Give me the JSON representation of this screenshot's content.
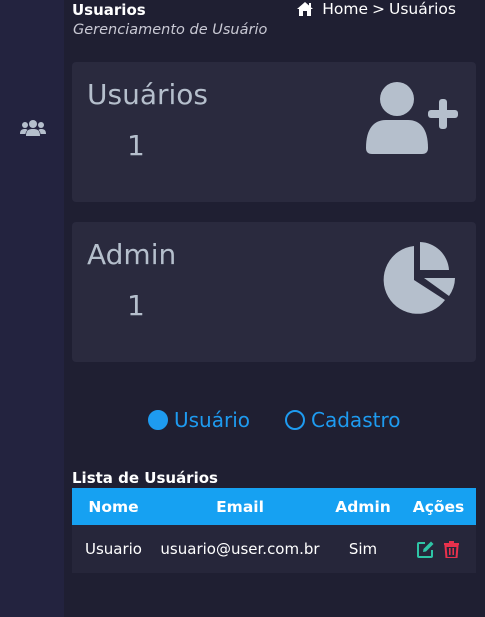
{
  "sidebar": {
    "items": [
      {
        "icon": "users-icon"
      }
    ]
  },
  "header": {
    "title": "Usuarios",
    "subtitle": "Gerenciamento de Usuário",
    "breadcrumb": {
      "home": "Home",
      "separator": ">",
      "current": "Usuários"
    }
  },
  "cards": [
    {
      "label": "Usuários",
      "value": "1",
      "icon": "user-plus-icon"
    },
    {
      "label": "Admin",
      "value": "1",
      "icon": "pie-chart-icon"
    }
  ],
  "view_toggle": {
    "options": [
      {
        "label": "Usuário",
        "checked": true
      },
      {
        "label": "Cadastro",
        "checked": false
      }
    ]
  },
  "user_list": {
    "title": "Lista de Usuários",
    "columns": [
      "Nome",
      "Email",
      "Admin",
      "Ações"
    ],
    "rows": [
      {
        "nome": "Usuario",
        "email": "usuario@user.com.br",
        "admin": "Sim",
        "actions": [
          "edit-icon",
          "trash-icon"
        ]
      }
    ]
  },
  "colors": {
    "accent": "#1e9bf0",
    "header_row": "#16a1f2",
    "edit": "#2ec4a6",
    "delete": "#e8314c"
  }
}
